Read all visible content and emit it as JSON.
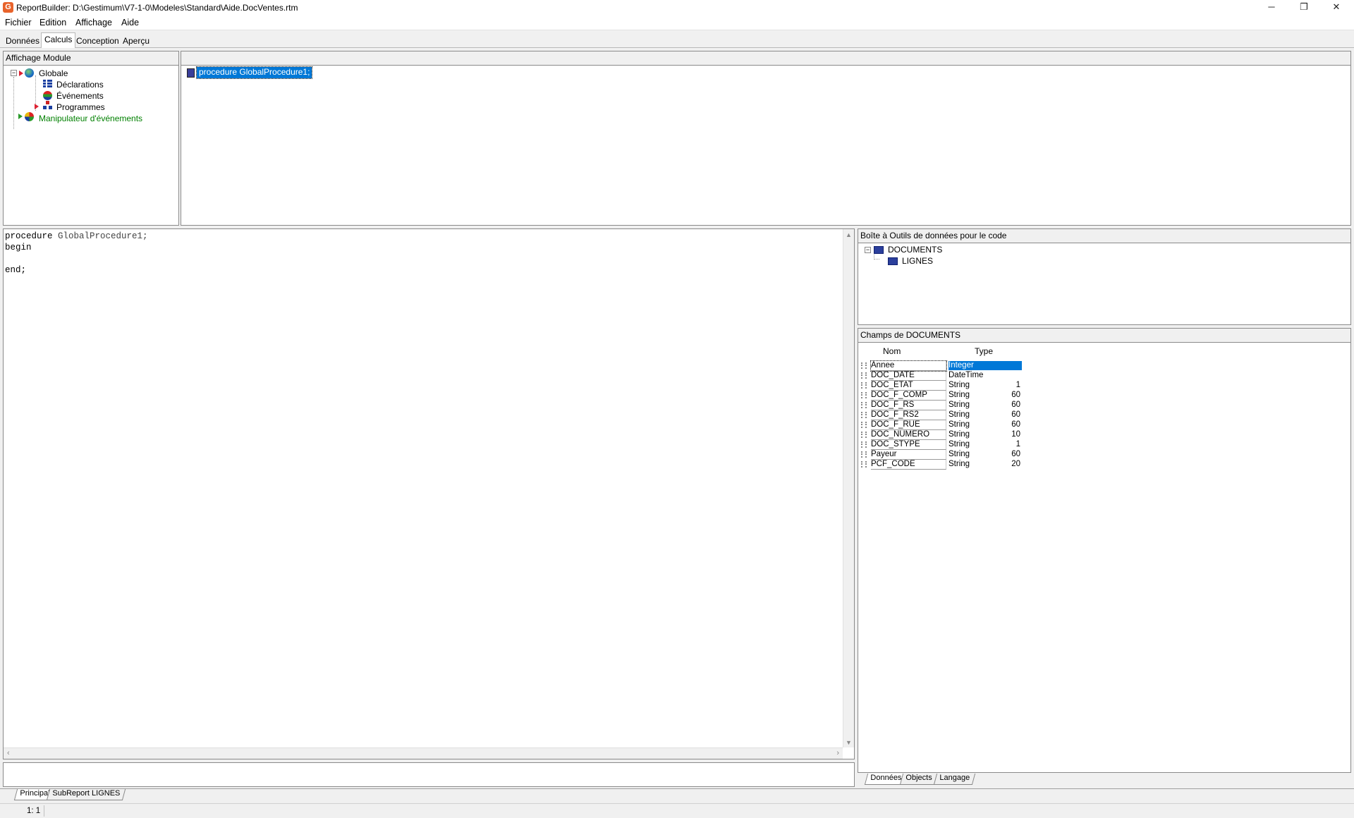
{
  "window": {
    "title": "ReportBuilder: D:\\Gestimum\\V7-1-0\\Modeles\\Standard\\Aide.DocVentes.rtm",
    "app_icon_letter": "G",
    "minimize": "─",
    "restore": "❐",
    "close": "✕"
  },
  "menu": {
    "file": "Fichier",
    "edit": "Edition",
    "view": "Affichage",
    "help": "Aide"
  },
  "tabs": {
    "data": "Données",
    "calc": "Calculs",
    "design": "Conception",
    "preview": "Aperçu"
  },
  "module_panel": {
    "header": "Affichage Module",
    "global": "Globale",
    "declarations": "Déclarations",
    "events": "Événements",
    "programs": "Programmes",
    "event_handlers": "Manipulateur d'événements"
  },
  "procedure_list": {
    "selected": "procedure GlobalProcedure1;"
  },
  "code": {
    "line1_kw": "procedure",
    "line1_name": " GlobalProcedure1;",
    "line2": "begin",
    "line3": "",
    "line4": "end;"
  },
  "toolbox": {
    "header": "Boîte à Outils de données pour le code",
    "pipeline1": "DOCUMENTS",
    "pipeline2": "LIGNES"
  },
  "fields": {
    "header": "Champs de DOCUMENTS",
    "col_name": "Nom",
    "col_type": "Type",
    "rows": [
      {
        "name": "Annee",
        "type": "Integer",
        "size": ""
      },
      {
        "name": "DOC_DATE",
        "type": "DateTime",
        "size": ""
      },
      {
        "name": "DOC_ETAT",
        "type": "String",
        "size": "1"
      },
      {
        "name": "DOC_F_COMP",
        "type": "String",
        "size": "60"
      },
      {
        "name": "DOC_F_RS",
        "type": "String",
        "size": "60"
      },
      {
        "name": "DOC_F_RS2",
        "type": "String",
        "size": "60"
      },
      {
        "name": "DOC_F_RUE",
        "type": "String",
        "size": "60"
      },
      {
        "name": "DOC_NUMERO",
        "type": "String",
        "size": "10"
      },
      {
        "name": "DOC_STYPE",
        "type": "String",
        "size": "1"
      },
      {
        "name": "Payeur",
        "type": "String",
        "size": "60"
      },
      {
        "name": "PCF_CODE",
        "type": "String",
        "size": "20"
      }
    ]
  },
  "toolbox_tabs": {
    "data": "Données",
    "objects": "Objects",
    "language": "Langage"
  },
  "report_tabs": {
    "main": "Principal",
    "sub": "SubReport LIGNES"
  },
  "status": {
    "position": "1: 1"
  },
  "colors": {
    "selection": "#0078d7",
    "event_handler_green": "#008000"
  }
}
